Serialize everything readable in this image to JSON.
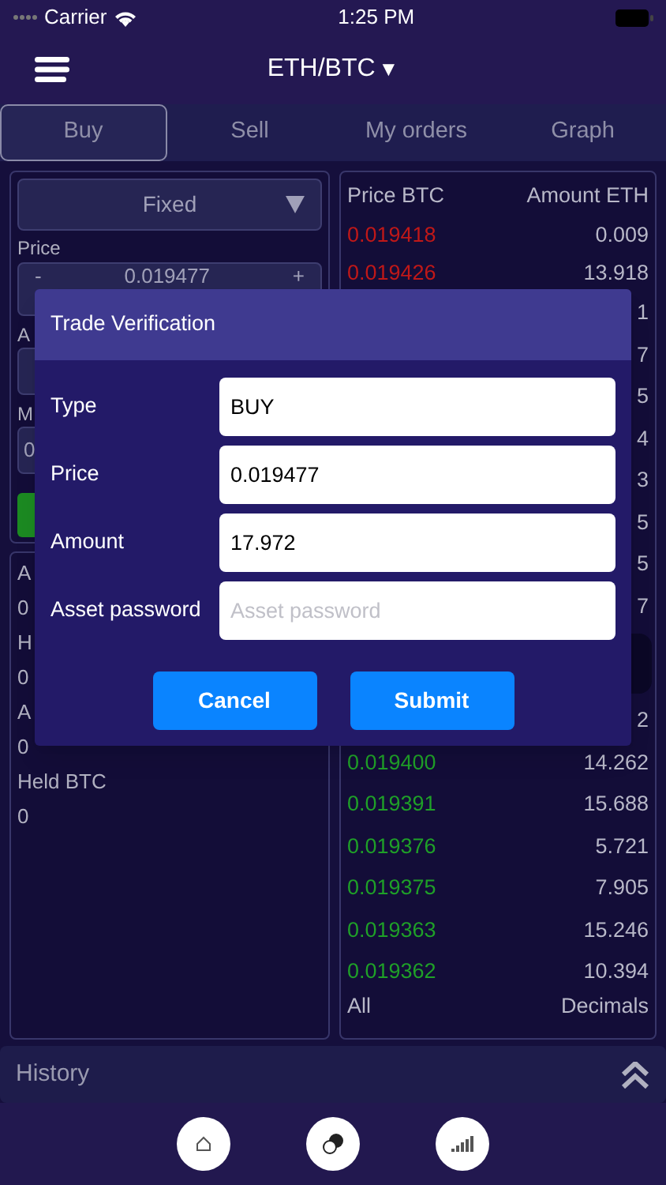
{
  "status_bar": {
    "carrier": "Carrier",
    "time": "1:25 PM"
  },
  "header": {
    "title": "ETH/BTC",
    "caret": "▼"
  },
  "tabs": [
    {
      "label": "Buy",
      "selected": true
    },
    {
      "label": "Sell",
      "selected": false
    },
    {
      "label": "My orders",
      "selected": false
    },
    {
      "label": "Graph",
      "selected": false
    }
  ],
  "order_form": {
    "order_type": "Fixed",
    "price_label": "Price",
    "decrement": "-",
    "price": "0.019477",
    "increment": "+",
    "amount_label": "A",
    "max_label": "M",
    "max_value": "0"
  },
  "balances": [
    {
      "label": "A",
      "value": "0"
    },
    {
      "label": "H",
      "value": "0"
    },
    {
      "label": "A",
      "value": "0"
    },
    {
      "label": "Held BTC",
      "value": "0"
    }
  ],
  "order_book": {
    "columns": [
      "Price BTC",
      "Amount ETH"
    ],
    "asks": [
      {
        "price": "0.019418",
        "amount": "0.009"
      },
      {
        "price": "0.019426",
        "amount": "13.918"
      },
      {
        "amount": "1"
      },
      {
        "amount": "7"
      },
      {
        "amount": "5"
      },
      {
        "amount": "4"
      },
      {
        "amount": "3"
      },
      {
        "amount": "5"
      },
      {
        "amount": "5"
      },
      {
        "amount": "7"
      }
    ],
    "bids": [
      {
        "amount": "2"
      },
      {
        "price": "0.019400",
        "amount": "14.262"
      },
      {
        "price": "0.019391",
        "amount": "15.688"
      },
      {
        "price": "0.019376",
        "amount": "5.721"
      },
      {
        "price": "0.019375",
        "amount": "7.905"
      },
      {
        "price": "0.019363",
        "amount": "15.246"
      },
      {
        "price": "0.019362",
        "amount": "10.394"
      }
    ],
    "footer": [
      "All",
      "Decimals"
    ]
  },
  "history": {
    "label": "History"
  },
  "dialog": {
    "title": "Trade Verification",
    "fields": [
      {
        "label": "Type",
        "value": "BUY"
      },
      {
        "label": "Price",
        "value": "0.019477"
      },
      {
        "label": "Amount",
        "value": "17.972"
      },
      {
        "label": "Asset password",
        "placeholder": "Asset password"
      }
    ],
    "buttons": [
      "Cancel",
      "Submit"
    ]
  }
}
